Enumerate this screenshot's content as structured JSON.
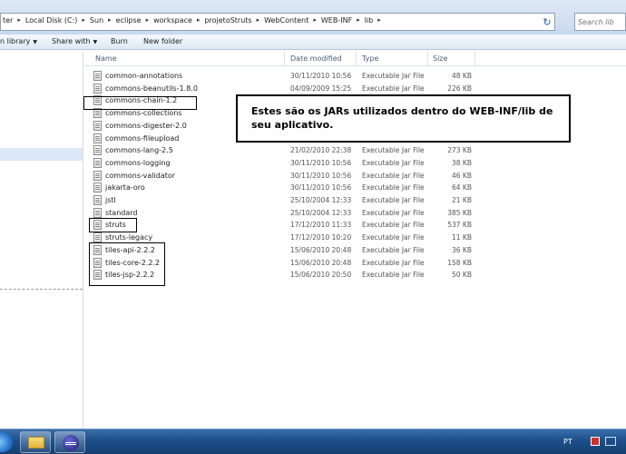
{
  "address_bar": {
    "crumbs": [
      "ter",
      "Local Disk (C:)",
      "Sun",
      "eclipse",
      "workspace",
      "projetoStruts",
      "WebContent",
      "WEB-INF",
      "lib"
    ],
    "search_placeholder": "Search lib"
  },
  "toolbar": {
    "include_label": "n library",
    "share_label": "Share with",
    "burn_label": "Burn",
    "new_folder_label": "New folder"
  },
  "columns": {
    "name": "Name",
    "date": "Date modified",
    "type": "Type",
    "size": "Size"
  },
  "files": [
    {
      "name": "common-annotations",
      "date": "30/11/2010 10:56",
      "type": "Executable Jar File",
      "size": "48 KB"
    },
    {
      "name": "commons-beanutils-1.8.0",
      "date": "04/09/2009 15:25",
      "type": "Executable Jar File",
      "size": "226 KB"
    },
    {
      "name": "commons-chain-1.2",
      "date": "",
      "type": "",
      "size": ""
    },
    {
      "name": "commons-collections",
      "date": "",
      "type": "",
      "size": ""
    },
    {
      "name": "commons-digester-2.0",
      "date": "",
      "type": "",
      "size": ""
    },
    {
      "name": "commons-fileupload",
      "date": "",
      "type": "",
      "size": ""
    },
    {
      "name": "commons-lang-2.5",
      "date": "21/02/2010 22:38",
      "type": "Executable Jar File",
      "size": "273 KB"
    },
    {
      "name": "commons-logging",
      "date": "30/11/2010 10:56",
      "type": "Executable Jar File",
      "size": "38 KB"
    },
    {
      "name": "commons-validator",
      "date": "30/11/2010 10:56",
      "type": "Executable Jar File",
      "size": "46 KB"
    },
    {
      "name": "jakarta-oro",
      "date": "30/11/2010 10:56",
      "type": "Executable Jar File",
      "size": "64 KB"
    },
    {
      "name": "jstl",
      "date": "25/10/2004 12:33",
      "type": "Executable Jar File",
      "size": "21 KB"
    },
    {
      "name": "standard",
      "date": "25/10/2004 12:33",
      "type": "Executable Jar File",
      "size": "385 KB"
    },
    {
      "name": "struts",
      "date": "17/12/2010 11:33",
      "type": "Executable Jar File",
      "size": "537 KB"
    },
    {
      "name": "struts-legacy",
      "date": "17/12/2010 10:20",
      "type": "Executable Jar File",
      "size": "11 KB"
    },
    {
      "name": "tiles-api-2.2.2",
      "date": "15/06/2010 20:48",
      "type": "Executable Jar File",
      "size": "36 KB"
    },
    {
      "name": "tiles-core-2.2.2",
      "date": "15/06/2010 20:48",
      "type": "Executable Jar File",
      "size": "158 KB"
    },
    {
      "name": "tiles-jsp-2.2.2",
      "date": "15/06/2010 20:50",
      "type": "Executable Jar File",
      "size": "50 KB"
    }
  ],
  "annotation": {
    "text": "Estes são os JARs utilizados dentro do WEB-INF/lib de seu aplicativo."
  },
  "taskbar": {
    "language": "PT"
  }
}
